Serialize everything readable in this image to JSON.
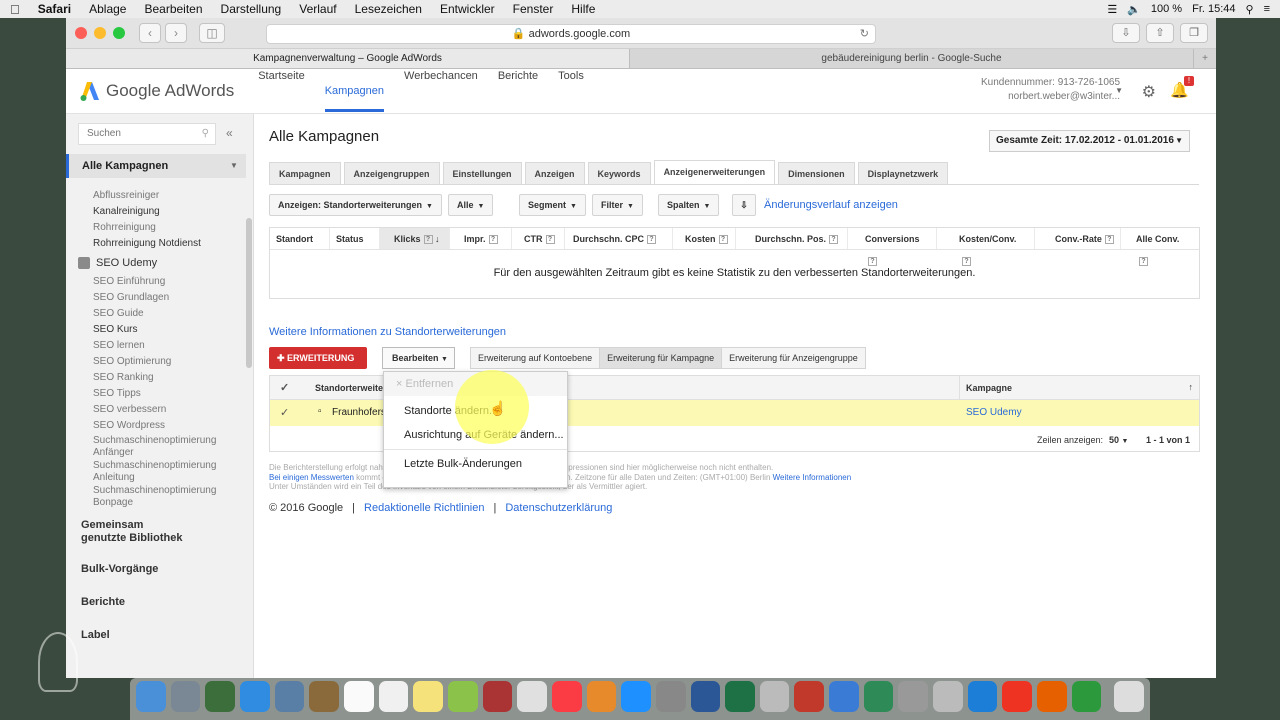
{
  "menubar": {
    "app": "Safari",
    "items": [
      "Ablage",
      "Bearbeiten",
      "Darstellung",
      "Verlauf",
      "Lesezeichen",
      "Entwickler",
      "Fenster",
      "Hilfe"
    ],
    "battery": "100 %",
    "time": "Fr. 15:44"
  },
  "browser": {
    "url": "adwords.google.com",
    "tabs": [
      "Kampagnenverwaltung – Google AdWords",
      "gebäudereinigung berlin - Google-Suche"
    ]
  },
  "header": {
    "logo": "Google AdWords",
    "nav": [
      "Startseite",
      "Kampagnen",
      "Werbechancen",
      "Berichte",
      "Tools"
    ],
    "customer": "Kundennummer: 913-726-1065",
    "email": "norbert.weber@w3inter...",
    "notif_badge": "!"
  },
  "sidebar": {
    "search_placeholder": "Suchen",
    "all_campaigns": "Alle Kampagnen",
    "items_top": [
      "Abflussreiniger",
      "Kanalreinigung",
      "Rohrreinigung",
      "Rohrreinigung Notdienst"
    ],
    "campaign": "SEO Udemy",
    "items": [
      "SEO Einführung",
      "SEO Grundlagen",
      "SEO Guide",
      "SEO Kurs",
      "SEO lernen",
      "SEO Optimierung",
      "SEO Ranking",
      "SEO Tipps",
      "SEO verbessern",
      "SEO Wordpress",
      "Suchmaschinenoptimierung Anfänger",
      "Suchmaschinenoptimierung Anleitung",
      "Suchmaschinenoptimierung Bonpage"
    ],
    "sections": [
      "Gemeinsam genutzte Bibliothek",
      "Bulk-Vorgänge",
      "Berichte",
      "Label"
    ]
  },
  "main": {
    "title": "Alle Kampagnen",
    "daterange": "Gesamte Zeit: 17.02.2012 - 01.01.2016",
    "tabs": [
      "Kampagnen",
      "Anzeigengruppen",
      "Einstellungen",
      "Anzeigen",
      "Keywords",
      "Anzeigenerweiterungen",
      "Dimensionen",
      "Displaynetzwerk"
    ],
    "filters": {
      "view": "Anzeigen: Standorterweiterungen",
      "all": "Alle",
      "segment": "Segment",
      "filter": "Filter",
      "columns": "Spalten"
    },
    "history": "Änderungsverlauf anzeigen",
    "stat_cols": [
      "Standort",
      "Status",
      "Klicks",
      "Impr.",
      "CTR",
      "Durchschn. CPC",
      "Kosten",
      "Durchschn. Pos.",
      "Conversions",
      "Kosten/Conv.",
      "Conv.-Rate",
      "Alle Conv."
    ],
    "no_data": "Für den ausgewählten Zeitraum gibt es keine Statistik zu den verbesserten Standorterweiterungen.",
    "more_info": "Weitere Informationen zu Standorterweiterungen",
    "add_btn": "ERWEITERUNG",
    "edit_btn": "Bearbeiten",
    "segments": [
      "Erweiterung auf Kontoebene",
      "Erweiterung für Kampagne",
      "Erweiterung für Anzeigengruppe"
    ],
    "table": {
      "col1": "Standorterweite",
      "col2": "Kampagne",
      "row_name": "Fraunhofers",
      "row_campaign": "SEO Udemy",
      "rows_label": "Zeilen anzeigen:",
      "rows_value": "50",
      "range": "1 - 1 von 1"
    },
    "dropdown": [
      "Entfernen",
      "Standorte ändern...",
      "Ausrichtung auf Geräte ändern...",
      "Letzte Bulk-Änderungen"
    ],
    "disclaimer": {
      "l1": "Die Berichterstellung erfolgt nahezu in Echtzeit. Erst kürzlich erhaltene Klicks und Impressionen sind hier möglicherweise noch nicht enthalten.",
      "l2_link": "Bei einigen Messwerten",
      "l2": "kommt es zu einer Verzögerung von mindestens 18 Stunden. Zeitzone für alle Daten und Zeiten: (GMT+01:00) Berlin",
      "l2_link2": "Weitere Informationen",
      "l3": "Unter Umständen wird ein Teil des Inventars von einem Drittanbieter bereitgestellt, der als Vermittler agiert."
    },
    "footer": {
      "copy": "© 2016 Google",
      "l1": "Redaktionelle Richtlinien",
      "l2": "Datenschutzerklärung",
      "sep": "|"
    }
  },
  "colors": {
    "accent": "#2a6ad8",
    "red": "#d32f2f",
    "highlight": "#fbf9b3"
  }
}
